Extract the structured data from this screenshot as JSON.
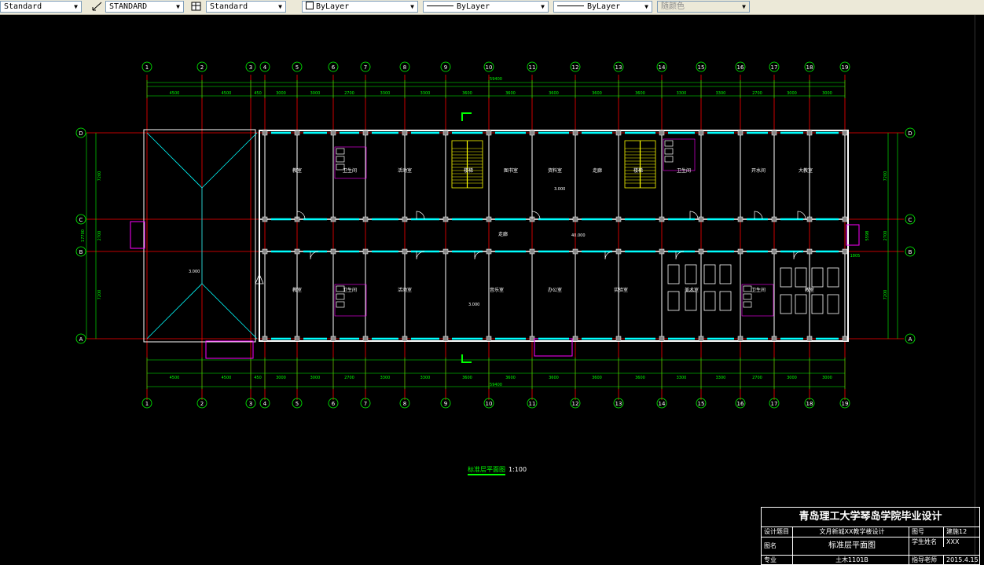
{
  "toolbar": {
    "text_style": "Standard",
    "dim_style": "STANDARD",
    "table_style": "Standard",
    "layer": "ByLayer",
    "linetype": "ByLayer",
    "lineweight": "ByLayer",
    "plot_color": "随颜色"
  },
  "grid": {
    "columns": [
      "1",
      "2",
      "3",
      "4",
      "5",
      "6",
      "7",
      "8",
      "9",
      "10",
      "11",
      "12",
      "13",
      "14",
      "15",
      "16",
      "17",
      "18",
      "19"
    ],
    "rows": [
      "D",
      "C",
      "B",
      "A"
    ]
  },
  "dims": {
    "top_bays": [
      "4500",
      "4500",
      "450",
      "3000",
      "3000",
      "2700",
      "3300",
      "3300",
      "3600",
      "3600",
      "3600",
      "3600",
      "3600",
      "3300",
      "3300",
      "2700",
      "3000",
      "3000"
    ],
    "top_total": "59400",
    "bottom_total": "59400",
    "left_outer": "17700",
    "left_parts": [
      "7200",
      "2700",
      "7200"
    ],
    "right_parts": [
      "7200",
      "2700",
      "7200"
    ],
    "right_outer": "5598",
    "right_small": "1805"
  },
  "rooms": {
    "top": [
      "教室",
      "卫生间",
      "活动室",
      "楼梯",
      "图书室",
      "资料室",
      "走廊",
      "楼梯",
      "卫生间",
      "开水间",
      "大教室"
    ],
    "bottom": [
      "教室",
      "卫生间",
      "活动室",
      "音乐室",
      "办公室",
      "实验室",
      "美术室",
      "卫生间",
      "教室"
    ],
    "corridor": "走廊"
  },
  "levels": {
    "corridor": "40.000",
    "room_a": "3.000",
    "room_b": "3.000"
  },
  "caption": {
    "title": "标准层平面图",
    "scale": "1:100"
  },
  "title_block": {
    "school": "青岛理工大学琴岛学院毕业设计",
    "r1": [
      "设计题目",
      "文月新城XX教学楼设计",
      "图号",
      "建施12"
    ],
    "r2": [
      "图名",
      "标准层平面图",
      "学生姓名",
      "XXX"
    ],
    "r3": [
      "专业",
      "土木1101B",
      "指导老师",
      "XXX"
    ],
    "date": "2015.4.15"
  },
  "colors": {
    "grid_axis": "#ff0000",
    "dim": "#00ff00",
    "wall": "#ffffff",
    "window": "#00ffff",
    "stair": "#ffff00",
    "partition": "#ff00ff"
  }
}
